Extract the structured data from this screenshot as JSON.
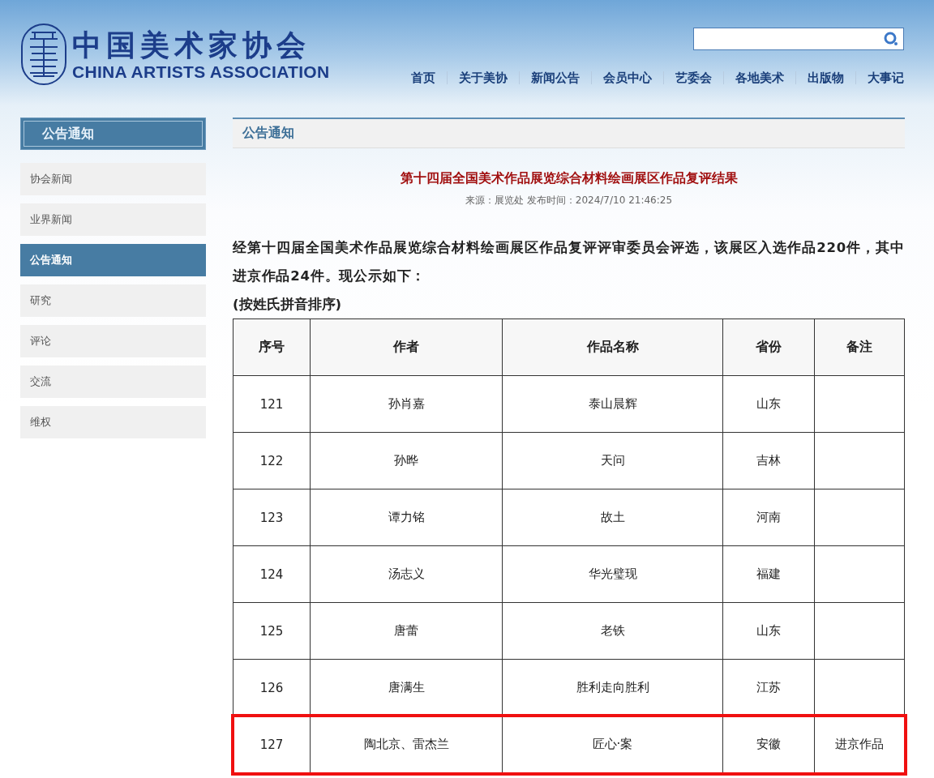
{
  "header": {
    "logo_cn": "中国美术家协会",
    "logo_en": "CHINA ARTISTS ASSOCIATION",
    "nav": [
      "首页",
      "关于美协",
      "新闻公告",
      "会员中心",
      "艺委会",
      "各地美术",
      "出版物",
      "大事记"
    ]
  },
  "sidebar": {
    "title": "公告通知",
    "items": [
      {
        "label": "协会新闻",
        "selected": false
      },
      {
        "label": "业界新闻",
        "selected": false
      },
      {
        "label": "公告通知",
        "selected": true
      },
      {
        "label": "研究",
        "selected": false
      },
      {
        "label": "评论",
        "selected": false
      },
      {
        "label": "交流",
        "selected": false
      },
      {
        "label": "维权",
        "selected": false
      }
    ]
  },
  "content": {
    "section_title": "公告通知",
    "article": {
      "title": "第十四届全国美术作品展览综合材料绘画展区作品复评结果",
      "meta": "来源：展览处 发布时间：2024/7/10 21:46:25",
      "intro": "经第十四届全国美术作品展览综合材料绘画展区作品复评评审委员会评选，该展区入选作品220件，其中进京作品24件。现公示如下：",
      "note": "(按姓氏拼音排序)"
    },
    "table": {
      "columns": [
        "序号",
        "作者",
        "作品名称",
        "省份",
        "备注"
      ],
      "rows": [
        {
          "cells": [
            "121",
            "孙肖嘉",
            "泰山晨辉",
            "山东",
            ""
          ],
          "highlighted": false
        },
        {
          "cells": [
            "122",
            "孙晔",
            "天问",
            "吉林",
            ""
          ],
          "highlighted": false
        },
        {
          "cells": [
            "123",
            "谭力铭",
            "故土",
            "河南",
            ""
          ],
          "highlighted": false
        },
        {
          "cells": [
            "124",
            "汤志义",
            "华光璧现",
            "福建",
            ""
          ],
          "highlighted": false
        },
        {
          "cells": [
            "125",
            "唐蕾",
            "老铁",
            "山东",
            ""
          ],
          "highlighted": false
        },
        {
          "cells": [
            "126",
            "唐满生",
            "胜利走向胜利",
            "江苏",
            ""
          ],
          "highlighted": false
        },
        {
          "cells": [
            "127",
            "陶北京、雷杰兰",
            "匠心·案",
            "安徽",
            "进京作品"
          ],
          "highlighted": true
        }
      ]
    }
  }
}
